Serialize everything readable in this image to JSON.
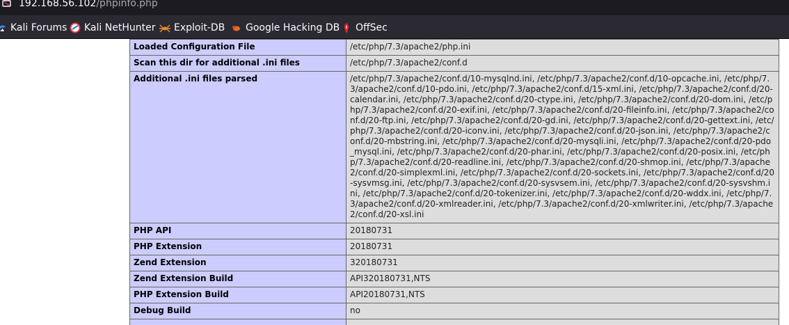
{
  "browser": {
    "url_host": "192.168.56.102",
    "url_path": "/phpinfo.php",
    "bookmarks": [
      {
        "label": "Kali Forums",
        "icon": "kali-dragon-icon"
      },
      {
        "label": "Kali NetHunter",
        "icon": "nethunter-icon"
      },
      {
        "label": "Exploit-DB",
        "icon": "exploit-db-spider-icon"
      },
      {
        "label": "Google Hacking DB",
        "icon": "ghdb-bug-icon"
      },
      {
        "label": "OffSec",
        "icon": "offsec-icon"
      }
    ]
  },
  "phpinfo": {
    "rows": [
      {
        "name": "Loaded Configuration File",
        "value": "/etc/php/7.3/apache2/php.ini"
      },
      {
        "name": "Scan this dir for additional .ini files",
        "value": "/etc/php/7.3/apache2/conf.d"
      },
      {
        "name": "Additional .ini files parsed",
        "value": "/etc/php/7.3/apache2/conf.d/10-mysqlnd.ini, /etc/php/7.3/apache2/conf.d/10-opcache.ini, /etc/php/7.3/apache2/conf.d/10-pdo.ini, /etc/php/7.3/apache2/conf.d/15-xml.ini, /etc/php/7.3/apache2/conf.d/20-calendar.ini, /etc/php/7.3/apache2/conf.d/20-ctype.ini, /etc/php/7.3/apache2/conf.d/20-dom.ini, /etc/php/7.3/apache2/conf.d/20-exif.ini, /etc/php/7.3/apache2/conf.d/20-fileinfo.ini, /etc/php/7.3/apache2/conf.d/20-ftp.ini, /etc/php/7.3/apache2/conf.d/20-gd.ini, /etc/php/7.3/apache2/conf.d/20-gettext.ini, /etc/php/7.3/apache2/conf.d/20-iconv.ini, /etc/php/7.3/apache2/conf.d/20-json.ini, /etc/php/7.3/apache2/conf.d/20-mbstring.ini, /etc/php/7.3/apache2/conf.d/20-mysqli.ini, /etc/php/7.3/apache2/conf.d/20-pdo_mysql.ini, /etc/php/7.3/apache2/conf.d/20-phar.ini, /etc/php/7.3/apache2/conf.d/20-posix.ini, /etc/php/7.3/apache2/conf.d/20-readline.ini, /etc/php/7.3/apache2/conf.d/20-shmop.ini, /etc/php/7.3/apache2/conf.d/20-simplexml.ini, /etc/php/7.3/apache2/conf.d/20-sockets.ini, /etc/php/7.3/apache2/conf.d/20-sysvmsg.ini, /etc/php/7.3/apache2/conf.d/20-sysvsem.ini, /etc/php/7.3/apache2/conf.d/20-sysvshm.ini, /etc/php/7.3/apache2/conf.d/20-tokenizer.ini, /etc/php/7.3/apache2/conf.d/20-wddx.ini, /etc/php/7.3/apache2/conf.d/20-xmlreader.ini, /etc/php/7.3/apache2/conf.d/20-xmlwriter.ini, /etc/php/7.3/apache2/conf.d/20-xsl.ini"
      },
      {
        "name": "PHP API",
        "value": "20180731"
      },
      {
        "name": "PHP Extension",
        "value": "20180731"
      },
      {
        "name": "Zend Extension",
        "value": "320180731"
      },
      {
        "name": "Zend Extension Build",
        "value": "API320180731,NTS"
      },
      {
        "name": "PHP Extension Build",
        "value": "API20180731,NTS"
      },
      {
        "name": "Debug Build",
        "value": "no"
      }
    ]
  }
}
